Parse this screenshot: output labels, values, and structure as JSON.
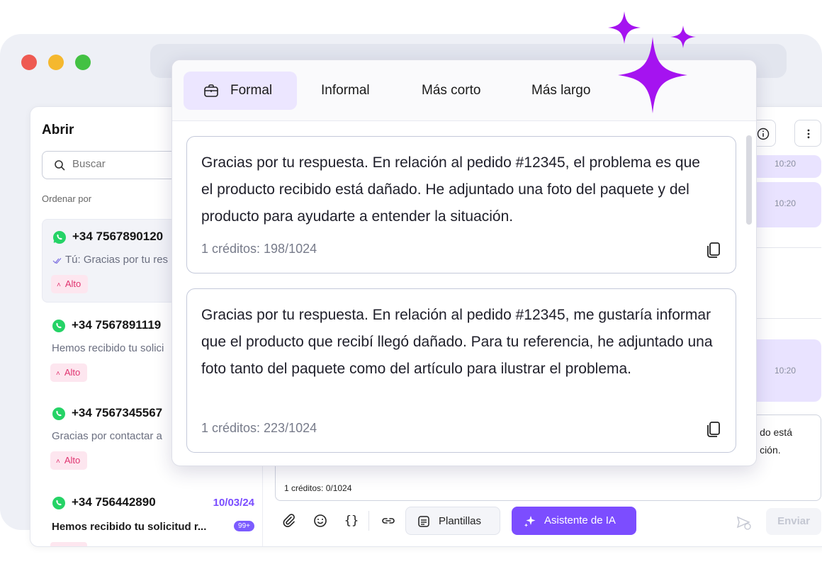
{
  "colors": {
    "accent": "#7c4dff",
    "sparkle": "#a513f0",
    "badge_text": "#e0336f",
    "whatsapp": "#25d366"
  },
  "sidebar": {
    "title": "Abrir",
    "search_placeholder": "Buscar",
    "sort_label": "Ordenar por",
    "conversations": [
      {
        "phone": "+34 7567890120",
        "preview": "Tú: Gracias por tu res",
        "badge": "Alto",
        "active": true
      },
      {
        "phone": "+34 7567891119",
        "preview": "Hemos recibido tu solici",
        "badge": "Alto"
      },
      {
        "phone": "+34 7567345567",
        "preview": "Gracias por contactar a",
        "badge": "Alto"
      },
      {
        "phone": "+34 756442890",
        "date": "10/03/24",
        "preview": "Hemos recibido tu solicitud r...",
        "count": "99+"
      }
    ]
  },
  "chat": {
    "times": [
      "10:20",
      "10:20",
      "10:20"
    ],
    "composer_text_1": "do está",
    "composer_text_2": "ción.",
    "composer_credits": "1 créditos: 0/1024",
    "templates_label": "Plantillas",
    "ai_label": "Asistente de IA",
    "send_label": "Enviar"
  },
  "popup": {
    "tabs": [
      "Formal",
      "Informal",
      "Más corto",
      "Más largo"
    ],
    "suggestions": [
      {
        "text": "Gracias por tu respuesta. En relación al pedido #12345, el problema es que el producto recibido está dañado. He adjuntado una foto del paquete y del producto para ayudarte a entender la situación.",
        "credits": "1 créditos: 198/1024"
      },
      {
        "text": "Gracias por tu respuesta. En relación al pedido #12345, me gustaría informar que el producto que recibí llegó dañado. Para tu referencia, he adjuntado una foto tanto del paquete como del artículo para ilustrar el problema.",
        "credits": "1 créditos: 223/1024"
      }
    ]
  }
}
